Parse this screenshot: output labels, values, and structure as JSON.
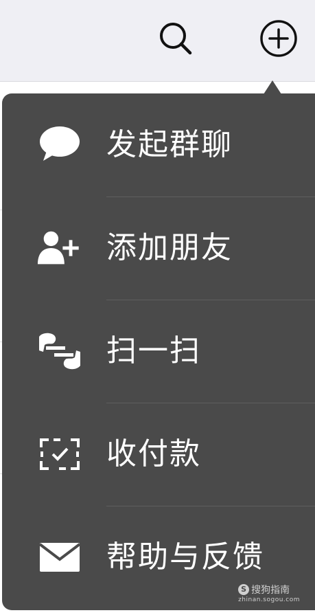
{
  "header": {
    "search_icon": "search-icon",
    "add_icon": "plus-circle-icon"
  },
  "menu": {
    "items": [
      {
        "label": "发起群聊",
        "icon": "chat-bubble-icon"
      },
      {
        "label": "添加朋友",
        "icon": "add-friend-icon"
      },
      {
        "label": "扫一扫",
        "icon": "scan-icon"
      },
      {
        "label": "收付款",
        "icon": "payment-scan-icon"
      },
      {
        "label": "帮助与反馈",
        "icon": "envelope-icon"
      }
    ]
  },
  "watermark": {
    "title": "搜狗指南",
    "logo": "S",
    "url": "zhinan.sogou.com"
  },
  "colors": {
    "popup_bg": "#4a4a4a",
    "top_bar_bg": "#efeff4",
    "text": "#ffffff"
  }
}
